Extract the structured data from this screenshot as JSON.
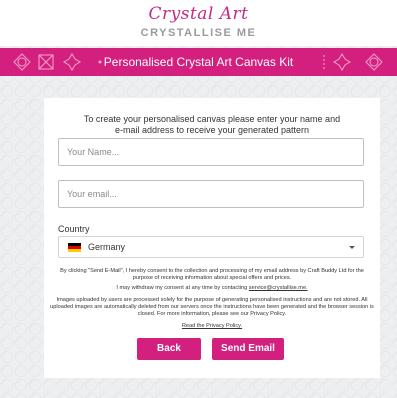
{
  "brand": {
    "logo_script": "Crystal Art",
    "logo_sub": "CRYSTALLISE ME",
    "accent": "#d31f7e"
  },
  "banner": {
    "title": "Personalised Crystal Art Canvas Kit"
  },
  "form": {
    "intro_line1": "To create your personalised canvas please enter your name and",
    "intro_line2": "e-mail address to receive your generated pattern",
    "name_placeholder": "Your Name...",
    "email_placeholder": "Your email...",
    "country_label": "Country",
    "country_value": "Germany",
    "consent_text": "By clicking \"Send E-Mail\", I hereby consent to the collection and processing of my email address by Craft Buddy Ltd for the purpose of receiving information about special offers and prices.",
    "withdraw_prefix": "I may withdraw my consent at any time by contacting",
    "withdraw_email": "service@crystallise.me.",
    "images_notice": "Images uploaded by users are processed solely for the purpose of generating personalised instructions and are not stored. All uploaded images are automatically deleted from our servers once the instructions have been generated and the browser session is closed. For more information, please see our Privacy Policy.",
    "privacy_link": "Read the Privacy Policy.",
    "back_label": "Back",
    "send_label": "Send Email"
  }
}
